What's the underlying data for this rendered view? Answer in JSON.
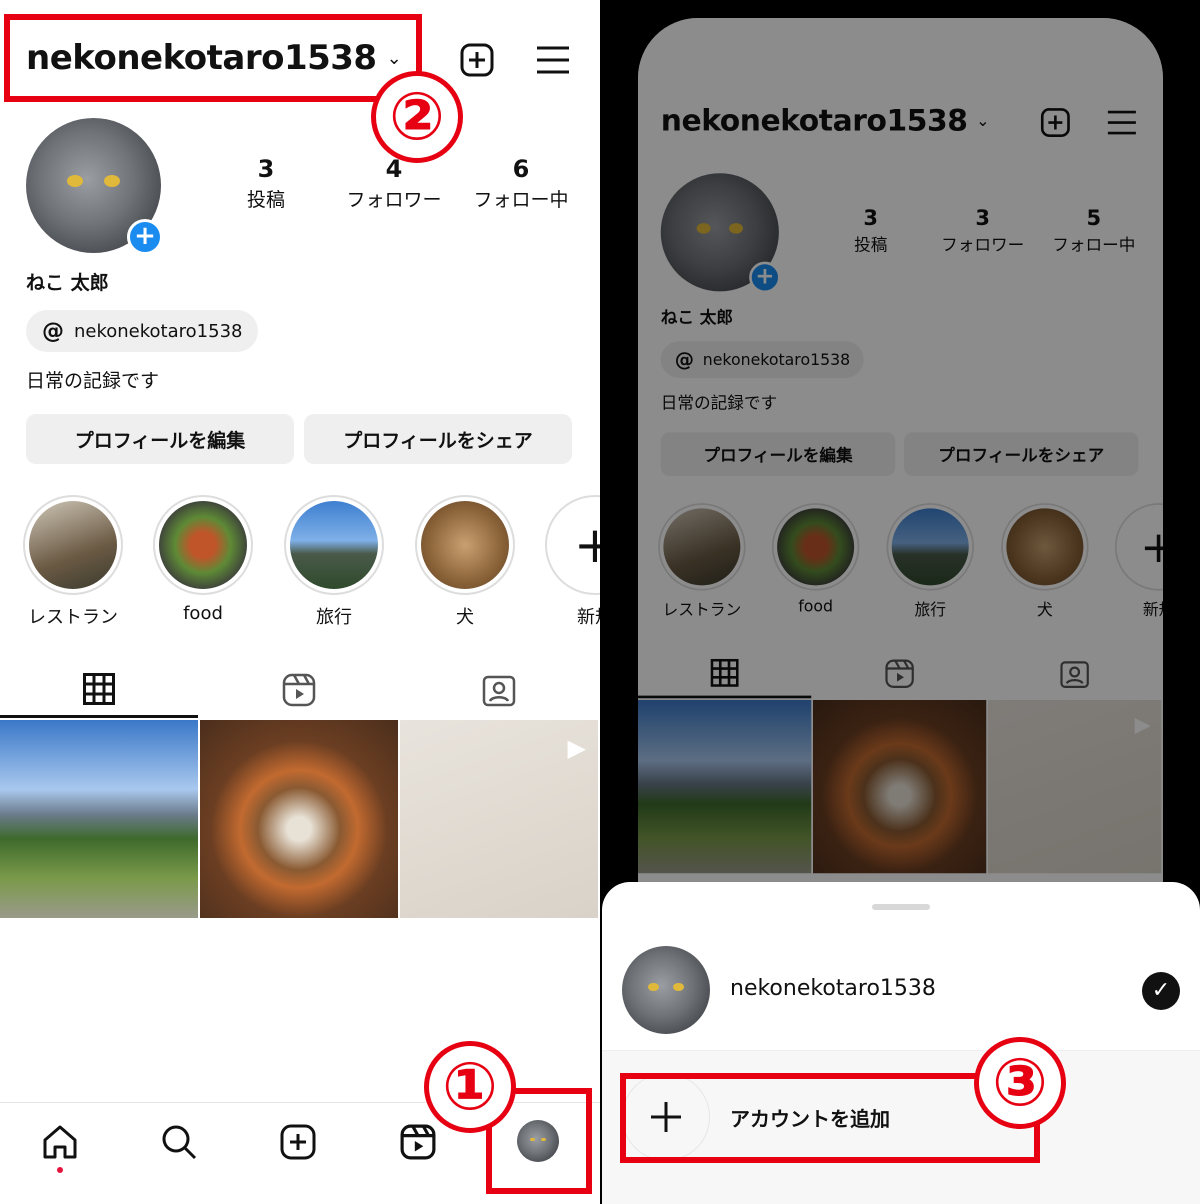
{
  "colors": {
    "accent": "#1a8cf0",
    "annotation_red": "#e60012"
  },
  "left": {
    "username": "nekonekotaro1538",
    "chevron": "⌄",
    "stats": [
      {
        "n": "3",
        "l": "投稿"
      },
      {
        "n": "4",
        "l": "フォロワー"
      },
      {
        "n": "6",
        "l": "フォロー中"
      }
    ],
    "name": "ねこ 太郎",
    "threads": "nekonekotaro1538",
    "bio": "日常の記録です",
    "edit": "プロフィールを編集",
    "share": "プロフィールをシェア",
    "highlights": [
      "レストラン",
      "food",
      "旅行",
      "犬",
      "新規"
    ]
  },
  "right": {
    "username": "nekonekotaro1538",
    "chevron": "⌄",
    "stats": [
      {
        "n": "3",
        "l": "投稿"
      },
      {
        "n": "3",
        "l": "フォロワー"
      },
      {
        "n": "5",
        "l": "フォロー中"
      }
    ],
    "name": "ねこ 太郎",
    "threads": "nekonekotaro1538",
    "bio": "日常の記録です",
    "edit": "プロフィールを編集",
    "share": "プロフィールをシェア",
    "highlights": [
      "レストラン",
      "food",
      "旅行",
      "犬",
      "新規"
    ]
  },
  "sheet": {
    "account": "nekonekotaro1538",
    "add_account": "アカウントを追加"
  },
  "annotations": {
    "one": "①",
    "two": "②",
    "three": "③"
  },
  "icons": [
    "plus-square-icon",
    "menu-icon",
    "threads-icon",
    "grid-icon",
    "reels-icon",
    "tagged-icon",
    "home-icon",
    "search-icon",
    "create-icon",
    "checkmark-icon"
  ]
}
